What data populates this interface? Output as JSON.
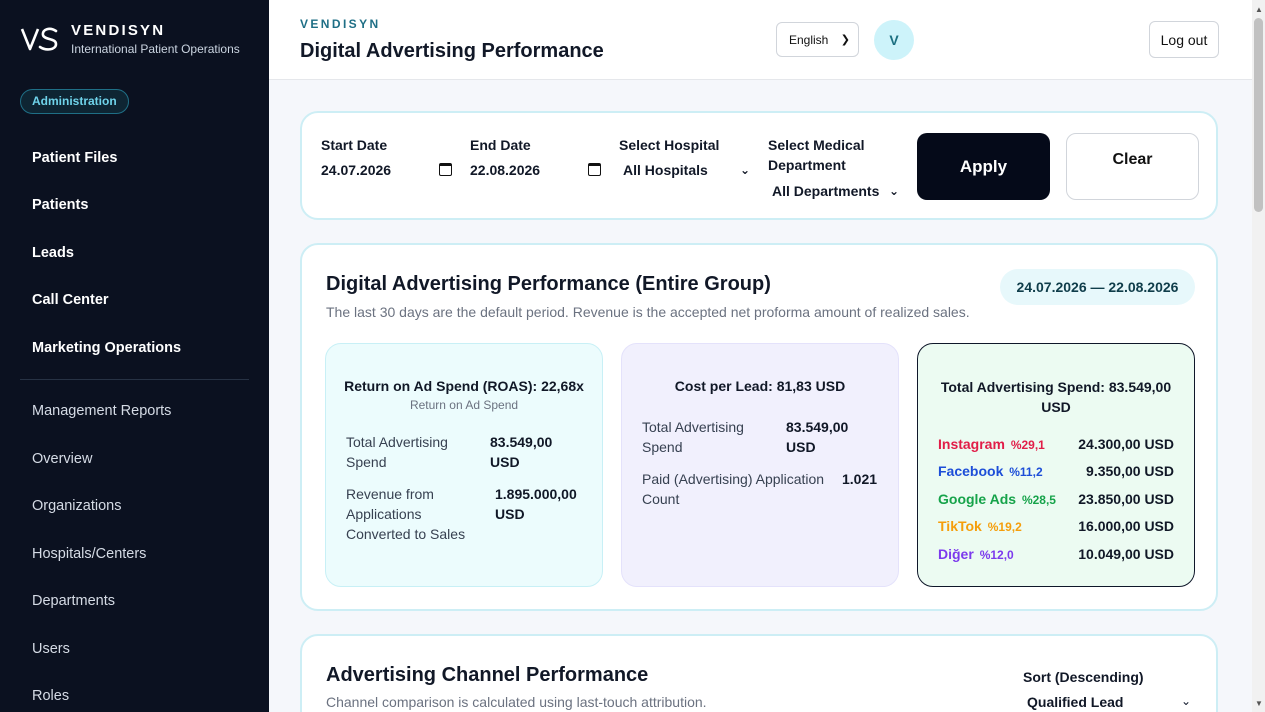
{
  "brand": {
    "name": "VENDISYN",
    "subtitle": "International Patient Operations",
    "role_badge": "Administration"
  },
  "sidebar": {
    "items": [
      {
        "label": "Patient Files"
      },
      {
        "label": "Patients"
      },
      {
        "label": "Leads"
      },
      {
        "label": "Call Center"
      },
      {
        "label": "Marketing Operations"
      }
    ],
    "secondary_items": [
      {
        "label": "Management Reports"
      },
      {
        "label": "Overview"
      },
      {
        "label": "Organizations"
      },
      {
        "label": "Hospitals/Centers"
      },
      {
        "label": "Departments"
      },
      {
        "label": "Users"
      },
      {
        "label": "Roles"
      }
    ]
  },
  "header": {
    "brand": "VENDISYN",
    "title": "Digital Advertising Performance",
    "language": "English",
    "avatar_initial": "V",
    "logout_label": "Log out"
  },
  "filters": {
    "start_date_label": "Start Date",
    "start_date_value": "24.07.2026",
    "end_date_label": "End Date",
    "end_date_value": "22.08.2026",
    "hospital_label": "Select Hospital",
    "hospital_value": "All Hospitals",
    "department_label": "Select Medical Department",
    "department_value": "All Departments",
    "apply_label": "Apply",
    "clear_label": "Clear"
  },
  "performance": {
    "title": "Digital Advertising Performance (Entire Group)",
    "subtitle": "The last 30 days are the default period. Revenue is the accepted net proforma amount of realized sales.",
    "date_range": "24.07.2026 — 22.08.2026",
    "roas": {
      "title": "Return on Ad Spend (ROAS): 22,68x",
      "hint": "Return on Ad Spend",
      "rows": [
        {
          "label": "Total Advertising Spend",
          "value": "83.549,00 USD"
        },
        {
          "label": "Revenue from Applications Converted to Sales",
          "value": "1.895.000,00 USD"
        }
      ]
    },
    "cpl": {
      "title": "Cost per Lead: 81,83 USD",
      "rows": [
        {
          "label": "Total Advertising Spend",
          "value": "83.549,00 USD"
        },
        {
          "label": "Paid (Advertising) Application Count",
          "value": "1.021"
        }
      ]
    },
    "spend": {
      "title": "Total Advertising Spend: 83.549,00 USD",
      "channels": [
        {
          "name": "Instagram",
          "share": "%29,1",
          "amount": "24.300,00 USD",
          "color": "#e11d48"
        },
        {
          "name": "Facebook",
          "share": "%11,2",
          "amount": "9.350,00 USD",
          "color": "#1d4ed8"
        },
        {
          "name": "Google Ads",
          "share": "%28,5",
          "amount": "23.850,00 USD",
          "color": "#16a34a"
        },
        {
          "name": "TikTok",
          "share": "%19,2",
          "amount": "16.000,00 USD",
          "color": "#f59e0b"
        },
        {
          "name": "Diğer",
          "share": "%12,0",
          "amount": "10.049,00 USD",
          "color": "#7c3aed"
        }
      ]
    }
  },
  "channel_performance": {
    "title": "Advertising Channel Performance",
    "subtitle": "Channel comparison is calculated using last-touch attribution.",
    "sort_label": "Sort (Descending)",
    "sort_value": "Qualified Lead"
  }
}
